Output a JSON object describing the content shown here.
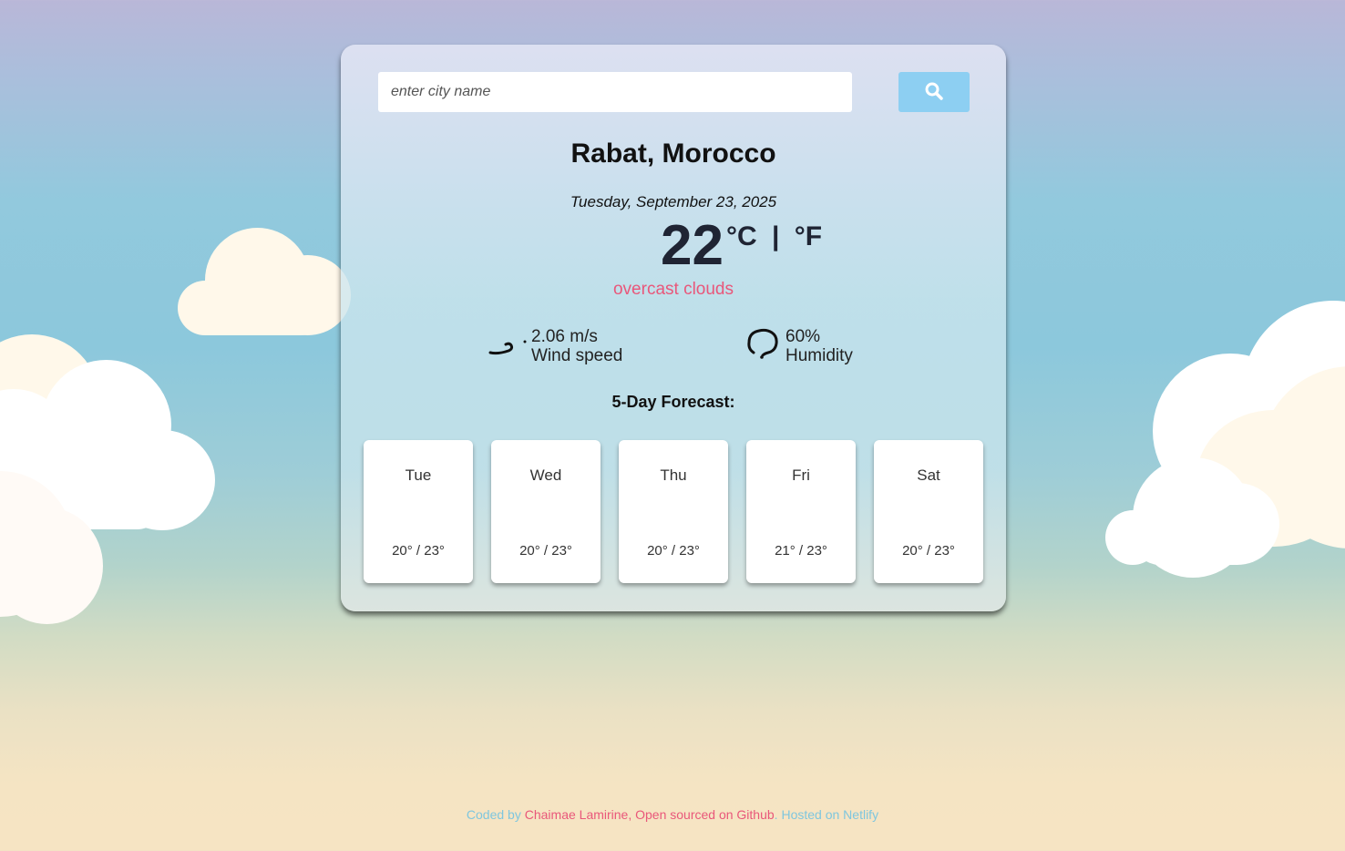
{
  "search": {
    "placeholder": "enter city name",
    "value": ""
  },
  "icons": {
    "search": "search-icon",
    "wind": "wind-icon",
    "humidity": "humidity-icon"
  },
  "weather": {
    "city": "Rabat, Morocco",
    "date": "Tuesday, September 23, 2025",
    "temperature": "22",
    "unit_c": "°C",
    "unit_sep": "|",
    "unit_f": "°F",
    "description": "overcast clouds",
    "wind_value": "2.06 m/s",
    "wind_label": "Wind speed",
    "humidity_value": "60%",
    "humidity_label": "Humidity"
  },
  "forecast": {
    "title": "5-Day Forecast:",
    "days": [
      {
        "day": "Tue",
        "range": "20° / 23°"
      },
      {
        "day": "Wed",
        "range": "20° / 23°"
      },
      {
        "day": "Thu",
        "range": "20° / 23°"
      },
      {
        "day": "Fri",
        "range": "21° / 23°"
      },
      {
        "day": "Sat",
        "range": "20° / 23°"
      }
    ]
  },
  "footer": {
    "coded_by": "Coded by ",
    "author": "Chaimae Lamirine",
    "sep1": ", ",
    "open_sourced": "Open sourced on Github",
    "sep2": ". ",
    "hosted": "Hosted on ",
    "netlify": "Netlify"
  },
  "colors": {
    "accent_pink": "#e9577a",
    "accent_blue": "#8dcff2",
    "footer_blue": "#7fc6de"
  }
}
